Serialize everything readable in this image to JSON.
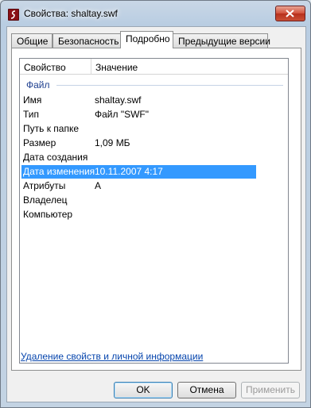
{
  "window": {
    "title": "Свойства: shaltay.swf"
  },
  "tabs": [
    {
      "label": "Общие"
    },
    {
      "label": "Безопасность"
    },
    {
      "label": "Подробно"
    },
    {
      "label": "Предыдущие версии"
    }
  ],
  "list": {
    "col_property": "Свойство",
    "col_value": "Значение",
    "group": "Файл",
    "rows": [
      {
        "key": "Имя",
        "value": "shaltay.swf"
      },
      {
        "key": "Тип",
        "value": "Файл \"SWF\""
      },
      {
        "key": "Путь к папке",
        "value": ""
      },
      {
        "key": "Размер",
        "value": "1,09 МБ"
      },
      {
        "key": "Дата создания",
        "value": ""
      },
      {
        "key": "Дата изменения",
        "value": "10.11.2007 4:17"
      },
      {
        "key": "Атрибуты",
        "value": "A"
      },
      {
        "key": "Владелец",
        "value": ""
      },
      {
        "key": "Компьютер",
        "value": ""
      }
    ],
    "selected_row": "Дата изменения"
  },
  "remove_link": "Удаление свойств и личной информации",
  "buttons": {
    "ok": "OK",
    "cancel": "Отмена",
    "apply": "Применить"
  },
  "colors": {
    "selection": "#3399ff",
    "link": "#0645ad",
    "close_button": "#c94f35"
  }
}
